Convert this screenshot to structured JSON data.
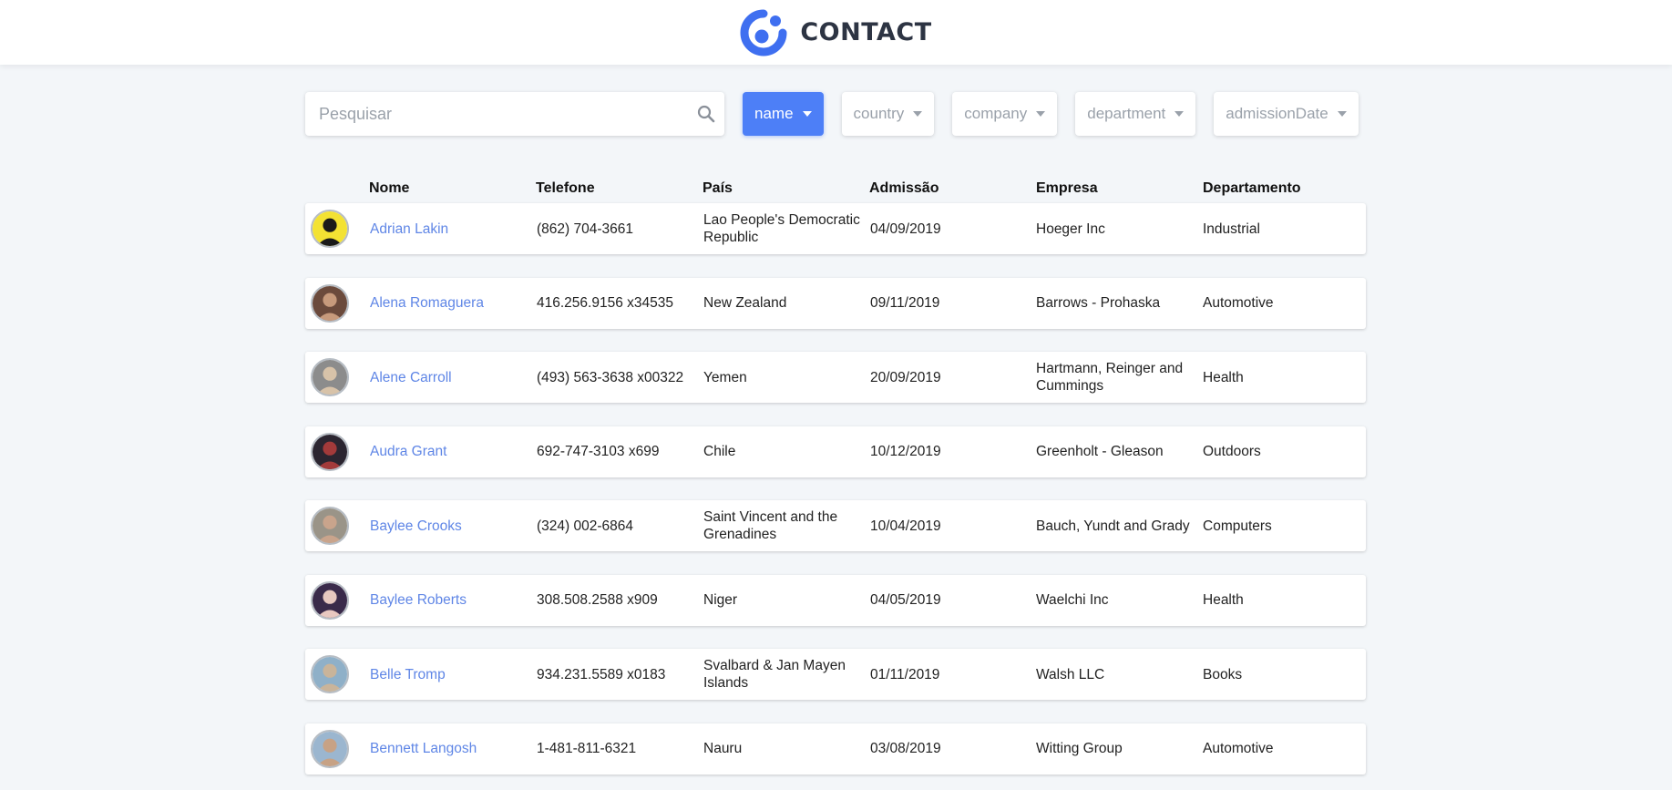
{
  "app": {
    "title": "CONTACT"
  },
  "search": {
    "placeholder": "Pesquisar"
  },
  "sort_filters": [
    {
      "label": "name",
      "active": true
    },
    {
      "label": "country",
      "active": false
    },
    {
      "label": "company",
      "active": false
    },
    {
      "label": "department",
      "active": false
    },
    {
      "label": "admissionDate",
      "active": false
    }
  ],
  "table": {
    "headers": {
      "name": "Nome",
      "phone": "Telefone",
      "country": "País",
      "admission": "Admissão",
      "company": "Empresa",
      "department": "Departamento"
    },
    "rows": [
      {
        "name": "Adrian Lakin",
        "phone": "(862) 704-3661",
        "country": "Lao People's Democratic Republic",
        "admission": "04/09/2019",
        "company": "Hoeger Inc",
        "department": "Industrial"
      },
      {
        "name": "Alena Romaguera",
        "phone": "416.256.9156 x34535",
        "country": "New Zealand",
        "admission": "09/11/2019",
        "company": "Barrows - Prohaska",
        "department": "Automotive"
      },
      {
        "name": "Alene Carroll",
        "phone": "(493) 563-3638 x00322",
        "country": "Yemen",
        "admission": "20/09/2019",
        "company": "Hartmann, Reinger and Cummings",
        "department": "Health"
      },
      {
        "name": "Audra Grant",
        "phone": "692-747-3103 x699",
        "country": "Chile",
        "admission": "10/12/2019",
        "company": "Greenholt - Gleason",
        "department": "Outdoors"
      },
      {
        "name": "Baylee Crooks",
        "phone": "(324) 002-6864",
        "country": "Saint Vincent and the Grenadines",
        "admission": "10/04/2019",
        "company": "Bauch, Yundt and Grady",
        "department": "Computers"
      },
      {
        "name": "Baylee Roberts",
        "phone": "308.508.2588 x909",
        "country": "Niger",
        "admission": "04/05/2019",
        "company": "Waelchi Inc",
        "department": "Health"
      },
      {
        "name": "Belle Tromp",
        "phone": "934.231.5589 x0183",
        "country": "Svalbard & Jan Mayen Islands",
        "admission": "01/11/2019",
        "company": "Walsh LLC",
        "department": "Books"
      },
      {
        "name": "Bennett Langosh",
        "phone": "1-481-811-6321",
        "country": "Nauru",
        "admission": "03/08/2019",
        "company": "Witting Group",
        "department": "Automotive"
      }
    ]
  },
  "colors": {
    "accent": "#4d7ff7",
    "link": "#5f86e6",
    "background": "#f3f6f9",
    "avatar_fills": [
      [
        "#f3e233",
        "#1a1a1a"
      ],
      [
        "#6b4a3c",
        "#c79a7c"
      ],
      [
        "#8c8c8c",
        "#d8c3a9"
      ],
      [
        "#2b2530",
        "#a33a3a"
      ],
      [
        "#9a9488",
        "#c9a48c"
      ],
      [
        "#3a2a4a",
        "#e8c8c0"
      ],
      [
        "#8fb0c8",
        "#c9b49a"
      ],
      [
        "#9bb6cf",
        "#c7a285"
      ]
    ]
  },
  "icons": {
    "logo": "contact-logo-icon",
    "search": "search-icon",
    "caret": "caret-down-icon",
    "avatar": "avatar-photo"
  }
}
